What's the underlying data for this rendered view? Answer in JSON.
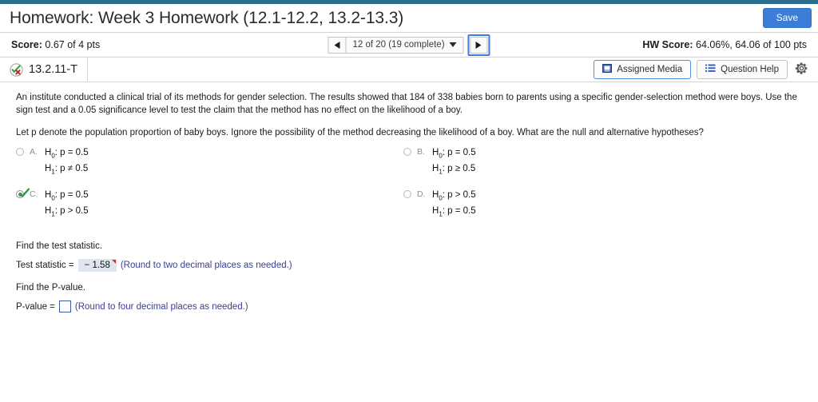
{
  "theme": {
    "accent": "#2d6e8e",
    "button_blue": "#3b7dd8",
    "hint_blue": "#3a3f8f",
    "answer_fill": "#dfe6ef",
    "flag_red": "#d32f2f",
    "check_green": "#2e9e3e"
  },
  "header": {
    "title": "Homework: Week 3 Homework (12.1-12.2, 13.2-13.3)",
    "save_label": "Save"
  },
  "scorebar": {
    "score_label": "Score:",
    "score_value": "0.67 of 4 pts",
    "prev_icon": "triangle-left-icon",
    "next_icon": "triangle-right-icon",
    "nav_value": "12 of 20 (19 complete)",
    "nav_caret": "chevron-down-icon",
    "hw_score_label": "HW Score:",
    "hw_score_value": "64.06%, 64.06 of 100 pts"
  },
  "question_header": {
    "status_icon": "partially-correct-icon",
    "question_number": "13.2.11-T",
    "assigned_media_label": "Assigned Media",
    "assigned_media_icon": "media-icon",
    "question_help_label": "Question Help",
    "question_help_icon": "list-icon",
    "settings_icon": "gear-icon"
  },
  "question": {
    "stem": "An institute conducted a clinical trial of its methods for gender selection. The results showed that 184 of 338 babies born to parents using a specific gender-selection method were boys. Use the sign test and a 0.05 significance level to test the claim that the method has no effect  on the likelihood of a boy.",
    "subquestion": "Let p denote the population proportion of baby boys. Ignore the possibility of the method decreasing the likelihood of a boy. What are the null and alternative hypotheses?",
    "choices": [
      {
        "letter": "A.",
        "h0": "H₀: p = 0.5",
        "h1": "H₁: p ≠ 0.5",
        "selected": false,
        "marked_correct": false
      },
      {
        "letter": "B.",
        "h0": "H₀: p = 0.5",
        "h1": "H₁: p ≥ 0.5",
        "selected": false,
        "marked_correct": false
      },
      {
        "letter": "C.",
        "h0": "H₀: p = 0.5",
        "h1": "H₁: p > 0.5",
        "selected": true,
        "marked_correct": true
      },
      {
        "letter": "D.",
        "h0": "H₀: p > 0.5",
        "h1": "H₁: p = 0.5",
        "selected": false,
        "marked_correct": false
      }
    ],
    "test_statistic": {
      "prompt": "Find the test statistic.",
      "label": "Test statistic =",
      "value": "− 1.58",
      "hint": "(Round to two decimal places as needed.)",
      "flagged": true
    },
    "p_value": {
      "prompt": "Find the P-value.",
      "label": "P-value =",
      "value": "",
      "placeholder": "",
      "hint": "(Round to four decimal places as needed.)"
    }
  }
}
